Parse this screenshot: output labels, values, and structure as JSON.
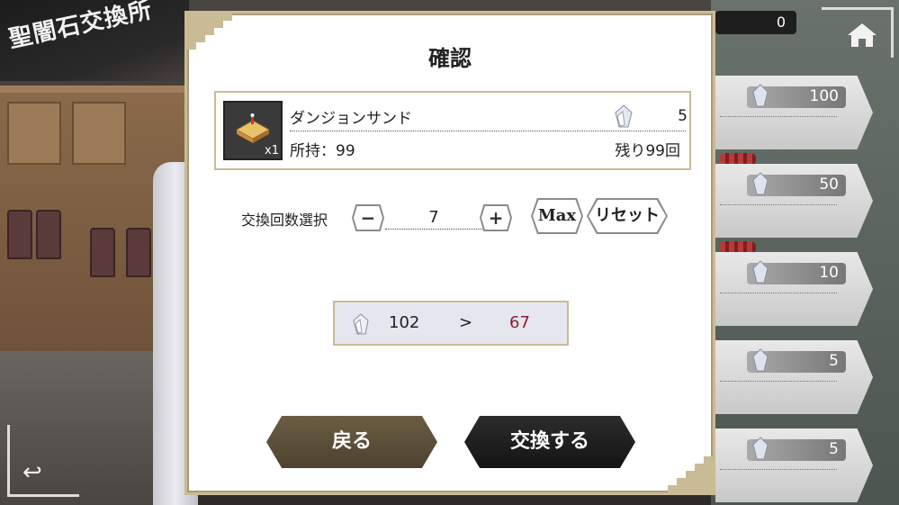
{
  "header": {
    "shop_title": "聖闇石交換所",
    "currency_count": "0"
  },
  "list": {
    "prices": [
      "100",
      "50",
      "10",
      "5",
      "5"
    ]
  },
  "dialog": {
    "title": "確認",
    "item": {
      "name": "ダンジョンサンド",
      "thumb_qty": "x1",
      "cost": "5",
      "owned": "所持：99",
      "remaining": "残り99回"
    },
    "quantity": {
      "label": "交換回数選択",
      "minus": "−",
      "plus": "+",
      "value": "7",
      "max_label": "Max",
      "reset_label": "リセット"
    },
    "balance": {
      "current": "102",
      "arrow": ">",
      "after": "67"
    },
    "buttons": {
      "back_label": "戻る",
      "exchange_label": "交換する"
    }
  },
  "colors": {
    "frame_gold": "#c9bb95",
    "back_button": "#5b4e38",
    "exchange_button": "#1c1c1c",
    "after_balance": "#8a2030"
  },
  "icons": {
    "crystal": "crystal-icon",
    "home": "home-icon",
    "return": "return-arrow-icon",
    "item": "sandwich-icon"
  }
}
